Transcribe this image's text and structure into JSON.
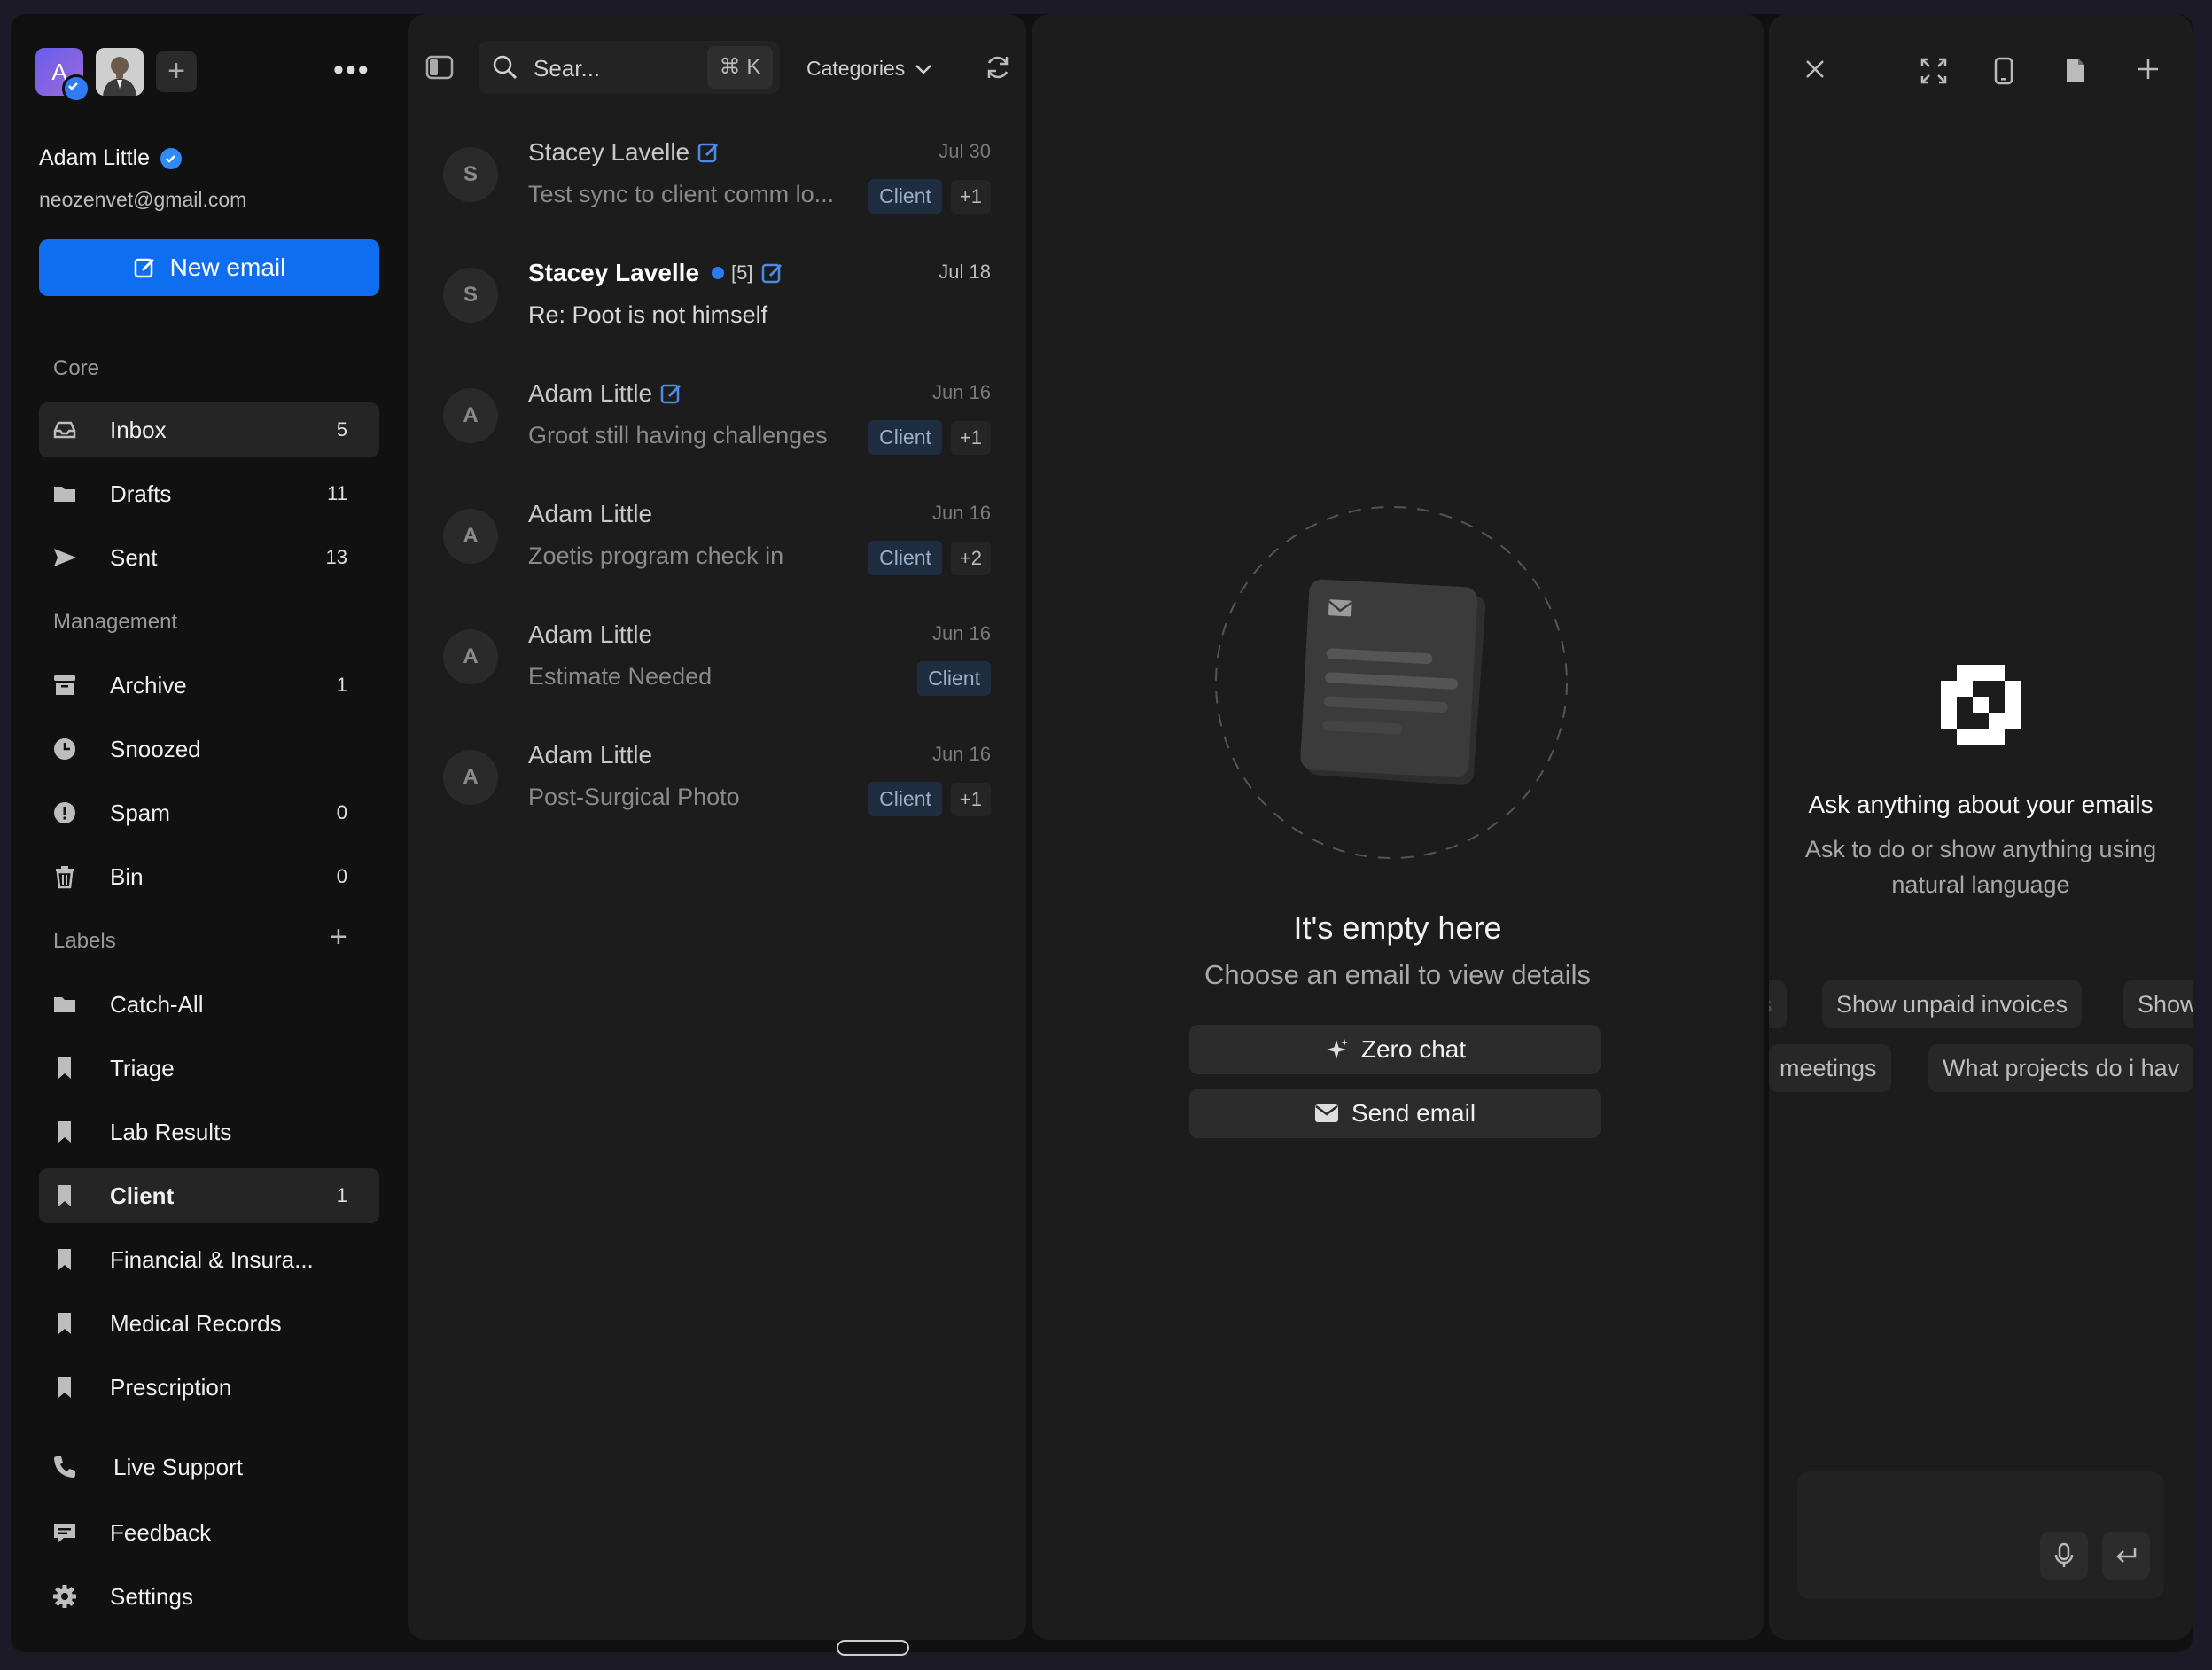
{
  "account": {
    "avatar_letter": "A",
    "name": "Adam Little",
    "email": "neozenvet@gmail.com",
    "add_account": "+"
  },
  "sidebar": {
    "new_email_label": "New email",
    "sections": {
      "core": "Core",
      "management": "Management",
      "labels": "Labels",
      "labels_add": "+"
    },
    "core_items": [
      {
        "label": "Inbox",
        "count": "5",
        "icon": "inbox-icon"
      },
      {
        "label": "Drafts",
        "count": "11",
        "icon": "folder-icon"
      },
      {
        "label": "Sent",
        "count": "13",
        "icon": "send-icon"
      }
    ],
    "management_items": [
      {
        "label": "Archive",
        "count": "1",
        "icon": "archive-icon"
      },
      {
        "label": "Snoozed",
        "count": "",
        "icon": "clock-icon"
      },
      {
        "label": "Spam",
        "count": "0",
        "icon": "alert-icon"
      },
      {
        "label": "Bin",
        "count": "0",
        "icon": "trash-icon"
      }
    ],
    "label_items": [
      {
        "label": "Catch-All",
        "count": "",
        "icon": "folder-icon"
      },
      {
        "label": "Triage",
        "count": "",
        "icon": "bookmark-icon"
      },
      {
        "label": "Lab Results",
        "count": "",
        "icon": "bookmark-icon"
      },
      {
        "label": "Client",
        "count": "1",
        "icon": "bookmark-icon"
      },
      {
        "label": "Financial & Insura...",
        "count": "",
        "icon": "bookmark-icon"
      },
      {
        "label": "Medical Records",
        "count": "",
        "icon": "bookmark-icon"
      },
      {
        "label": "Prescription",
        "count": "",
        "icon": "bookmark-icon"
      }
    ],
    "footer_items": [
      {
        "label": "Live Support",
        "icon": "phone-icon"
      },
      {
        "label": "Feedback",
        "icon": "feedback-icon"
      },
      {
        "label": "Settings",
        "icon": "gear-icon"
      }
    ]
  },
  "list": {
    "search_placeholder": "Sear...",
    "search_shortcut": "⌘ K",
    "categories_label": "Categories",
    "emails": [
      {
        "avatar": "S",
        "sender": "Stacey Lavelle",
        "date": "Jul 30",
        "subject": "Test sync to client comm lo...",
        "tag": "Client",
        "more": "+1",
        "unread": false,
        "thread": ""
      },
      {
        "avatar": "S",
        "sender": "Stacey Lavelle",
        "date": "Jul 18",
        "subject": "Re: Poot is not himself",
        "tag": "",
        "more": "",
        "unread": true,
        "thread": "[5]"
      },
      {
        "avatar": "A",
        "sender": "Adam Little",
        "date": "Jun 16",
        "subject": "Groot still having challenges",
        "tag": "Client",
        "more": "+1",
        "unread": false,
        "thread": ""
      },
      {
        "avatar": "A",
        "sender": "Adam Little",
        "date": "Jun 16",
        "subject": "Zoetis program check in",
        "tag": "Client",
        "more": "+2",
        "unread": false,
        "thread": ""
      },
      {
        "avatar": "A",
        "sender": "Adam Little",
        "date": "Jun 16",
        "subject": "Estimate Needed",
        "tag": "Client",
        "more": "",
        "unread": false,
        "thread": ""
      },
      {
        "avatar": "A",
        "sender": "Adam Little",
        "date": "Jun 16",
        "subject": "Post-Surgical Photo",
        "tag": "Client",
        "more": "+1",
        "unread": false,
        "thread": ""
      }
    ]
  },
  "detail": {
    "empty_title": "It's empty here",
    "empty_subtitle": "Choose an email to view details",
    "zero_chat_label": "Zero chat",
    "send_email_label": "Send email"
  },
  "chat": {
    "title": "Ask anything about your emails",
    "subtitle": "Ask to do or show anything using natural language",
    "suggestions_row1": [
      "Show unpaid invoices",
      "Show"
    ],
    "suggestions_row2": [
      "meetings",
      "What projects do i hav"
    ]
  },
  "colors": {
    "accent": "#0f6ef0",
    "tag_bg": "#1f2d40",
    "panel_bg": "#1c1c1c",
    "sidebar_bg": "#111111"
  }
}
